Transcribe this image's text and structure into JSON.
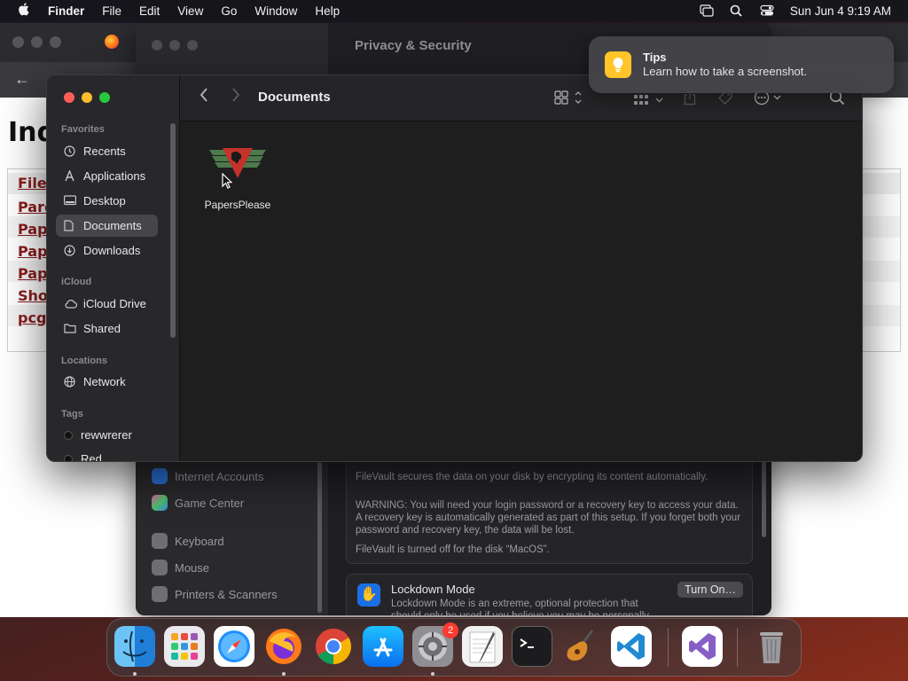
{
  "menubar": {
    "app_name": "Finder",
    "items": [
      "File",
      "Edit",
      "View",
      "Go",
      "Window",
      "Help"
    ],
    "clock": "Sun Jun 4  9:19 AM"
  },
  "browser": {
    "heading": "Ind",
    "links": [
      "File",
      "Pare",
      "Pape",
      "Pape",
      "Pape",
      "Shor",
      "pcgo"
    ]
  },
  "settings": {
    "title": "Privacy & Security",
    "sidebar": [
      "Internet Accounts",
      "Game Center",
      "Keyboard",
      "Mouse",
      "Printers & Scanners"
    ],
    "filevault_partial": "FileVault secures the data on your disk by encrypting its content automatically.",
    "warning": "WARNING: You will need your login password or a recovery key to access your data. A recovery key is automatically generated as part of this setup. If you forget both your password and recovery key, the data will be lost.",
    "filevault_status": "FileVault is turned off for the disk “MacOS”.",
    "lockdown_title": "Lockdown Mode",
    "lockdown_desc": "Lockdown Mode is an extreme, optional protection that should only be used if you believe you may be personally",
    "turn_on_label": "Turn On…"
  },
  "finder": {
    "title": "Documents",
    "sections": {
      "favorites": "Favorites",
      "icloud": "iCloud",
      "locations": "Locations",
      "tags": "Tags"
    },
    "favorites": [
      "Recents",
      "Applications",
      "Desktop",
      "Documents",
      "Downloads"
    ],
    "icloud": [
      "iCloud Drive",
      "Shared"
    ],
    "locations": [
      "Network"
    ],
    "tags": [
      "rewwrerer",
      "Red"
    ],
    "selected": "Documents",
    "files": [
      {
        "name": "PapersPlease"
      }
    ]
  },
  "tips": {
    "title": "Tips",
    "body": "Learn how to take a screenshot."
  },
  "dock": {
    "apps": [
      "Finder",
      "Launchpad",
      "Safari",
      "Firefox",
      "Chrome",
      "App Store",
      "System Settings",
      "TextEdit",
      "Terminal",
      "GarageBand",
      "Visual Studio Code",
      "Visual Studio",
      "Trash"
    ],
    "settings_badge": "2"
  },
  "colors": {
    "accent": "#1b6fe6",
    "tips_icon": "#ffc529",
    "badge": "#ff3b30",
    "link": "#8b1d1d"
  }
}
